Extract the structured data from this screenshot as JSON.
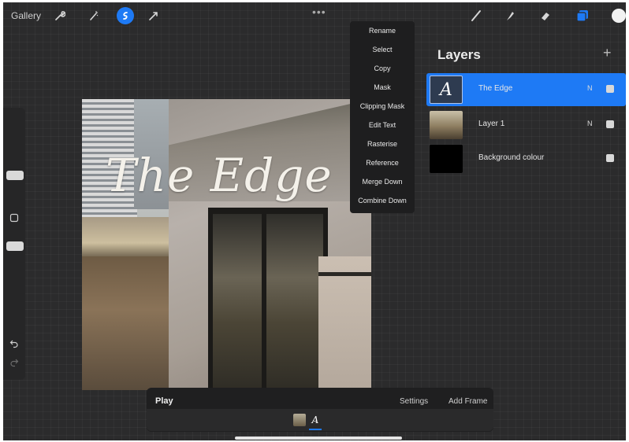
{
  "toolbar": {
    "gallery_label": "Gallery",
    "left_tools": [
      "wrench-icon",
      "magic-wand-icon",
      "selection-icon",
      "transform-icon"
    ],
    "right_tools": [
      "brush-icon",
      "smudge-icon",
      "eraser-icon",
      "layers-icon",
      "color-icon"
    ],
    "more_label": "•••"
  },
  "canvas": {
    "title_text": "The Edge"
  },
  "context_menu": {
    "items": [
      "Rename",
      "Select",
      "Copy",
      "Mask",
      "Clipping Mask",
      "Edit Text",
      "Rasterise",
      "Reference",
      "Merge Down",
      "Combine Down"
    ]
  },
  "layers": {
    "title": "Layers",
    "add_label": "+",
    "rows": [
      {
        "name": "The Edge",
        "mode": "N",
        "active": true,
        "thumb": "text"
      },
      {
        "name": "Layer 1",
        "mode": "N",
        "active": false,
        "thumb": "photo"
      },
      {
        "name": "Background colour",
        "mode": "",
        "active": false,
        "thumb": "black"
      }
    ]
  },
  "animation": {
    "play_label": "Play",
    "settings_label": "Settings",
    "add_frame_label": "Add Frame",
    "frame_text_glyph": "A"
  },
  "colors": {
    "accent": "#1e7af5",
    "background": "#2b2b2c"
  }
}
